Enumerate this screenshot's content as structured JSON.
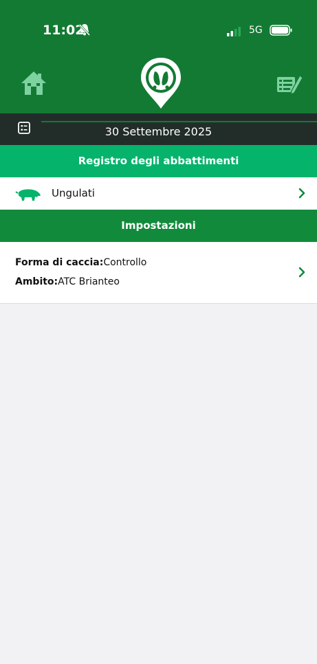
{
  "status_bar": {
    "time": "11:02",
    "network": "5G"
  },
  "header": {
    "home_icon": "home-icon",
    "logo_icon": "hoofprint-pin-logo",
    "register_icon": "edit-register-icon"
  },
  "date_bar": {
    "icon": "calendar-list-icon",
    "date": "30 Settembre 2025"
  },
  "register_section": {
    "title": "Registro degli abbattimenti",
    "items": [
      {
        "icon": "boar-icon",
        "label": "Ungulati"
      }
    ]
  },
  "settings_section": {
    "title": "Impostazioni",
    "hunt_form_label": "Forma di caccia:",
    "hunt_form_value": "Controllo",
    "area_label": "Ambito:",
    "area_value": "ATC Brianteo"
  },
  "colors": {
    "header": "#137a34",
    "date_bar": "#222d2a",
    "section_light": "#06b36b",
    "section_dark": "#128a3c",
    "accent": "#0e8a3c"
  }
}
